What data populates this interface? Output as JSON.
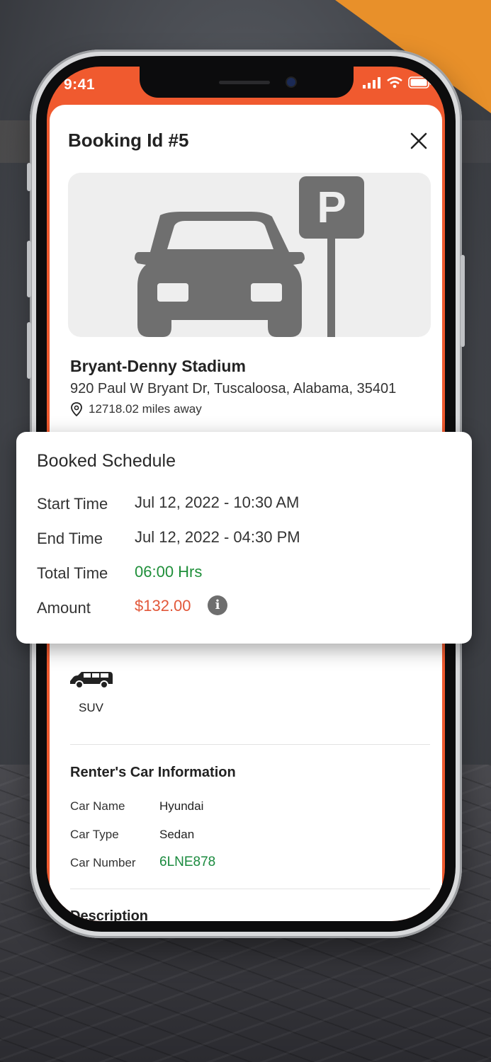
{
  "status_bar": {
    "time": "9:41"
  },
  "booking": {
    "title": "Booking Id #5",
    "place_name": "Bryant-Denny Stadium",
    "address": "920 Paul W Bryant Dr, Tuscaloosa, Alabama, 35401",
    "distance": "12718.02 miles away"
  },
  "schedule": {
    "title": "Booked Schedule",
    "rows": [
      {
        "label": "Start Time",
        "value": "Jul 12, 2022 - 10:30 AM"
      },
      {
        "label": "End Time",
        "value": "Jul 12, 2022 - 04:30 PM"
      },
      {
        "label": "Total Time",
        "value": "06:00 Hrs"
      },
      {
        "label": "Amount",
        "value": "$132.00"
      }
    ]
  },
  "vehicle": {
    "label": "SUV"
  },
  "renter_car": {
    "title": "Renter's Car Information",
    "rows": [
      {
        "label": "Car Name",
        "value": "Hyundai"
      },
      {
        "label": "Car Type",
        "value": "Sedan"
      },
      {
        "label": "Car Number",
        "value": "6LNE878"
      }
    ]
  },
  "description": {
    "title": "Description"
  },
  "colors": {
    "accent_orange": "#f05a2f",
    "green": "#1f8f3a",
    "amount_red": "#e2583a",
    "corner_orange": "#e8902a"
  },
  "icons": [
    "close-icon",
    "car-parking-illustration",
    "location-pin-icon",
    "suv-icon",
    "info-icon",
    "signal-icon",
    "wifi-icon",
    "battery-icon"
  ]
}
